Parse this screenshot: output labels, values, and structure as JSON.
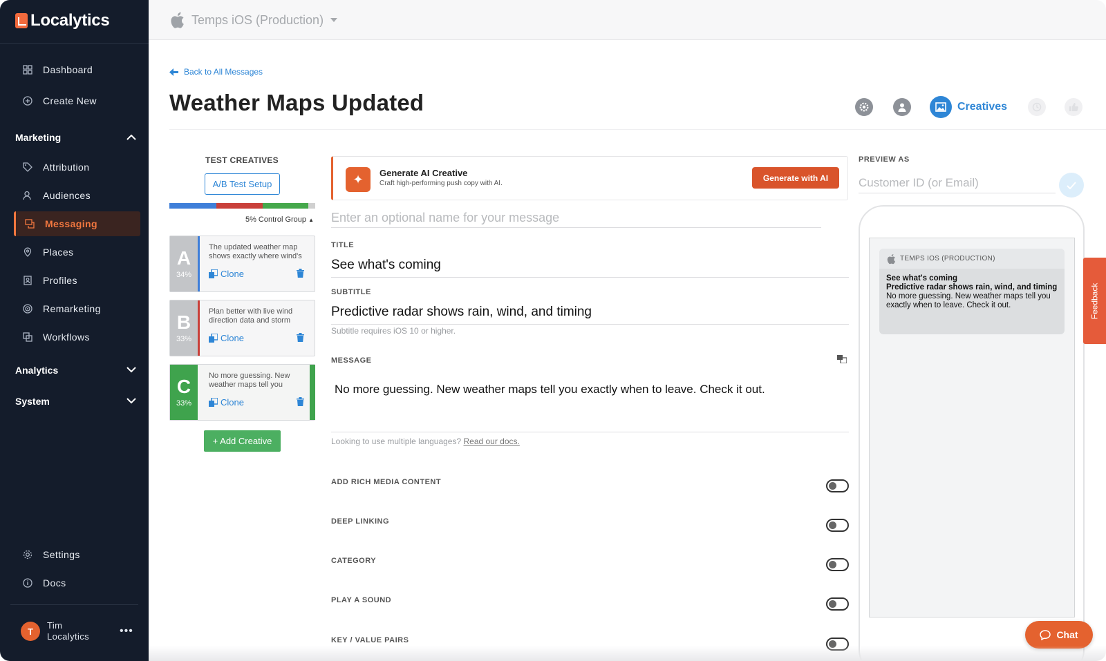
{
  "brand": {
    "name": "Localytics",
    "accent": "#f3773f",
    "link_color": "#2e86d6"
  },
  "sidebar": {
    "top_items": [
      {
        "label": "Dashboard",
        "icon": "grid-icon"
      },
      {
        "label": "Create New",
        "icon": "plus-circle-icon"
      }
    ],
    "marketing": {
      "label": "Marketing",
      "items": [
        {
          "label": "Attribution",
          "icon": "tag-icon"
        },
        {
          "label": "Audiences",
          "icon": "people-icon"
        },
        {
          "label": "Messaging",
          "icon": "message-icon",
          "active": true
        },
        {
          "label": "Places",
          "icon": "map-pin-icon"
        },
        {
          "label": "Profiles",
          "icon": "id-card-icon"
        },
        {
          "label": "Remarketing",
          "icon": "target-icon"
        },
        {
          "label": "Workflows",
          "icon": "workflow-icon"
        }
      ]
    },
    "analytics_label": "Analytics",
    "system_label": "System",
    "bottom_items": [
      {
        "label": "Settings",
        "icon": "gear-icon"
      },
      {
        "label": "Docs",
        "icon": "info-icon"
      }
    ],
    "user": {
      "initial": "T",
      "name": "Tim",
      "org": "Localytics"
    }
  },
  "topbar": {
    "app_name": "Temps iOS (Production)"
  },
  "header": {
    "back_link": "Back to All Messages",
    "title": "Weather Maps Updated",
    "active_step": "Creatives"
  },
  "test_creatives": {
    "title": "TEST CREATIVES",
    "ab_button": "A/B Test Setup",
    "control_group": "5% Control Group",
    "split_colors": [
      "#3f7fd9",
      "#c9403a",
      "#45a84b",
      "#d0d0d0"
    ],
    "creatives": [
      {
        "letter": "A",
        "percent": "34%",
        "text": "The updated weather map shows exactly where wind's",
        "clone": "Clone",
        "color": "#3f7fd9"
      },
      {
        "letter": "B",
        "percent": "33%",
        "text": "Plan better with live wind direction data and storm",
        "clone": "Clone",
        "color": "#c9403a"
      },
      {
        "letter": "C",
        "percent": "33%",
        "text": "No more guessing. New weather maps tell you",
        "clone": "Clone",
        "color": "#3fa34d",
        "selected": true
      }
    ],
    "add_button": "+ Add Creative"
  },
  "form": {
    "ai_title": "Generate AI Creative",
    "ai_subtitle": "Craft high-performing push copy with AI.",
    "ai_button": "Generate with AI",
    "name_placeholder": "Enter an optional name for your message",
    "title_label": "TITLE",
    "title_value": "See what's coming",
    "subtitle_label": "SUBTITLE",
    "subtitle_value": "Predictive radar shows rain, wind, and timing",
    "subtitle_hint": "Subtitle requires iOS 10 or higher.",
    "message_label": "MESSAGE",
    "message_value": "No more guessing. New weather maps tell you exactly when to leave. Check it out.",
    "languages_hint": "Looking to use multiple languages?",
    "languages_link": "Read our docs.",
    "toggles": [
      {
        "label": "ADD RICH MEDIA CONTENT",
        "on": false
      },
      {
        "label": "DEEP LINKING",
        "on": false
      },
      {
        "label": "CATEGORY",
        "on": false
      },
      {
        "label": "PLAY A SOUND",
        "on": false
      },
      {
        "label": "KEY / VALUE PAIRS",
        "on": false
      }
    ]
  },
  "preview": {
    "label": "PREVIEW AS",
    "input_placeholder": "Customer ID (or Email)",
    "notif_app": "TEMPS IOS (PRODUCTION)",
    "notif_title": "See what's coming",
    "notif_subtitle": "Predictive radar shows rain, wind, and timing",
    "notif_message": "No more guessing. New weather maps tell you exactly when to leave. Check it out."
  },
  "feedback_label": "Feedback",
  "chat_label": "Chat"
}
